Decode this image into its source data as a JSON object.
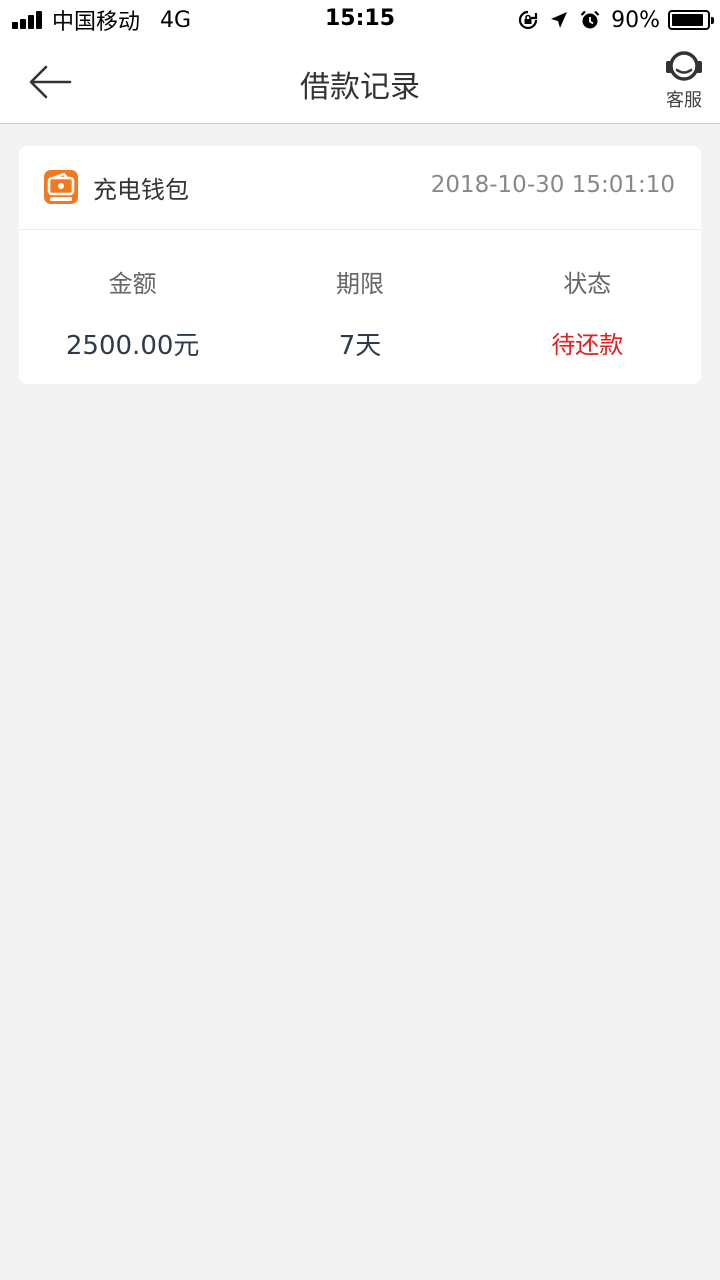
{
  "status_bar": {
    "carrier": "中国移动",
    "network": "4G",
    "time": "15:15",
    "battery": "90%",
    "battery_level": 0.9
  },
  "nav": {
    "title": "借款记录",
    "service_label": "客服"
  },
  "record": {
    "app_name": "充电钱包",
    "time": "2018-10-30 15:01:10",
    "columns": [
      {
        "label": "金额",
        "value": "2500.00元"
      },
      {
        "label": "期限",
        "value": "7天"
      },
      {
        "label": "状态",
        "value": "待还款"
      }
    ]
  },
  "colors": {
    "status_pending": "#e32020",
    "logo_orange": "#f4781f"
  }
}
